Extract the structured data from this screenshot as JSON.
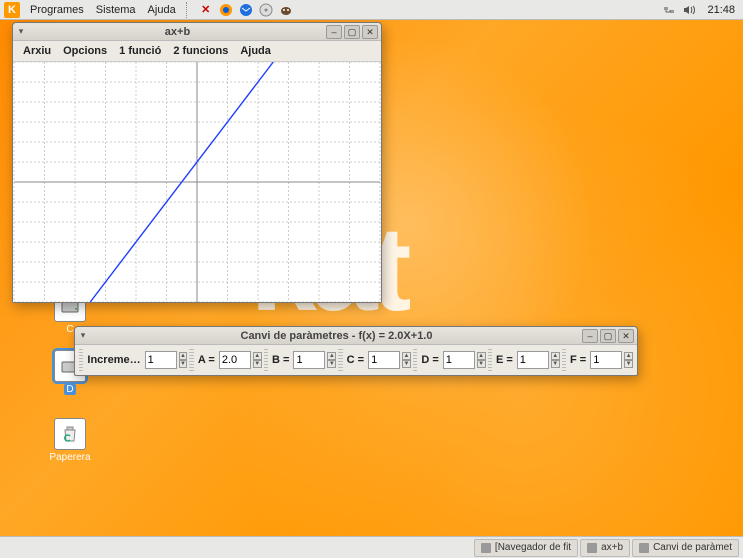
{
  "panel": {
    "menus": [
      "Programes",
      "Sistema",
      "Ajuda"
    ],
    "clock": "21:48"
  },
  "desktop_icons": {
    "c": "C",
    "d": "D",
    "trash": "Paperera"
  },
  "plot_window": {
    "title": "ax+b",
    "menus": [
      "Arxiu",
      "Opcions",
      "1 funció",
      "2 funcions",
      "Ajuda"
    ]
  },
  "param_window": {
    "title": "Canvi de paràmetres - f(x) = 2.0X+1.0",
    "increment_label": "Increme…",
    "increment_value": "1",
    "fields": [
      {
        "label": "A =",
        "value": "2.0"
      },
      {
        "label": "B =",
        "value": "1"
      },
      {
        "label": "C =",
        "value": "1"
      },
      {
        "label": "D =",
        "value": "1"
      },
      {
        "label": "E =",
        "value": "1"
      },
      {
        "label": "F =",
        "value": "1"
      }
    ]
  },
  "taskbar": {
    "items": [
      "[Navegador de fit",
      "ax+b",
      "Canvi de paràmet"
    ]
  },
  "chart_data": {
    "type": "line",
    "title": "",
    "xlabel": "",
    "ylabel": "",
    "xlim": [
      -6,
      6
    ],
    "ylim": [
      -6,
      6
    ],
    "grid": true,
    "series": [
      {
        "name": "f(x)=2.0x+1.0",
        "x": [
          -3.5,
          2.5
        ],
        "y": [
          -6,
          6
        ]
      }
    ]
  }
}
